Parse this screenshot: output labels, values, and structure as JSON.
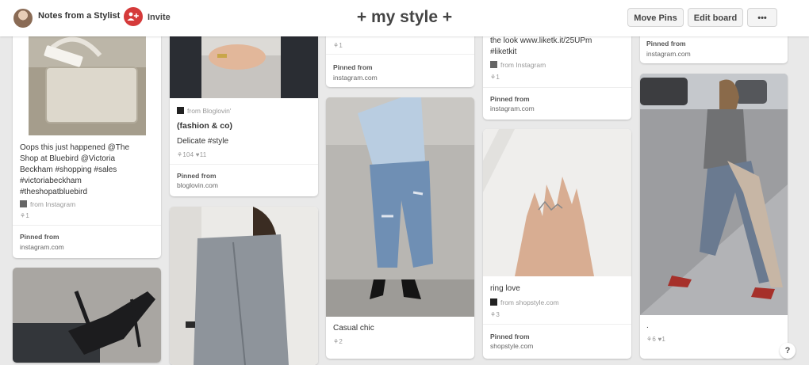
{
  "header": {
    "owner_name": "Notes from a Stylist",
    "invite_label": "Invite",
    "board_title": "+ my style +",
    "move_pins_label": "Move Pins",
    "edit_board_label": "Edit board",
    "more_label": "•••"
  },
  "col1": {
    "pin1": {
      "description_lines": [
        "Oops this just happened @The",
        "Shop at Bluebird @Victoria",
        "Beckham #shopping #sales",
        "#victoriabeckham",
        "#theshopatbluebird"
      ],
      "source": "from Instagram",
      "stats": "⚘1",
      "pinned_from": "Pinned from",
      "domain": "instagram.com"
    }
  },
  "col2": {
    "pin1": {
      "source": "from Bloglovin'",
      "title": "(fashion & co)",
      "description": "Delicate #style",
      "stats": "⚘104 ♥11",
      "pinned_from": "Pinned from",
      "domain": "bloglovin.com"
    }
  },
  "col3": {
    "pin1": {
      "stats": "⚘1",
      "pinned_from": "Pinned from",
      "domain": "instagram.com"
    },
    "pin2": {
      "description": "Casual chic",
      "stats": "⚘2"
    }
  },
  "col4": {
    "pin1": {
      "description_lines": [
        "the look www.liketk.it/25UPm",
        "#liketkit"
      ],
      "source": "from Instagram",
      "stats": "⚘1",
      "pinned_from": "Pinned from",
      "domain": "instagram.com"
    },
    "pin2": {
      "description": "ring love",
      "source": "from shopstyle.com",
      "stats": "⚘3",
      "pinned_from": "Pinned from",
      "domain": "shopstyle.com"
    }
  },
  "col5": {
    "pin1": {
      "pinned_from": "Pinned from",
      "domain": "instagram.com"
    },
    "pin2": {
      "description": ".",
      "stats": "⚘6 ♥1"
    }
  },
  "help_label": "?",
  "icons": {
    "avatar": "avatar-image",
    "invite": "add-user-icon",
    "more": "ellipsis-icon"
  },
  "colors": {
    "accent": "#d53a3a",
    "background": "#e9e9e9"
  }
}
